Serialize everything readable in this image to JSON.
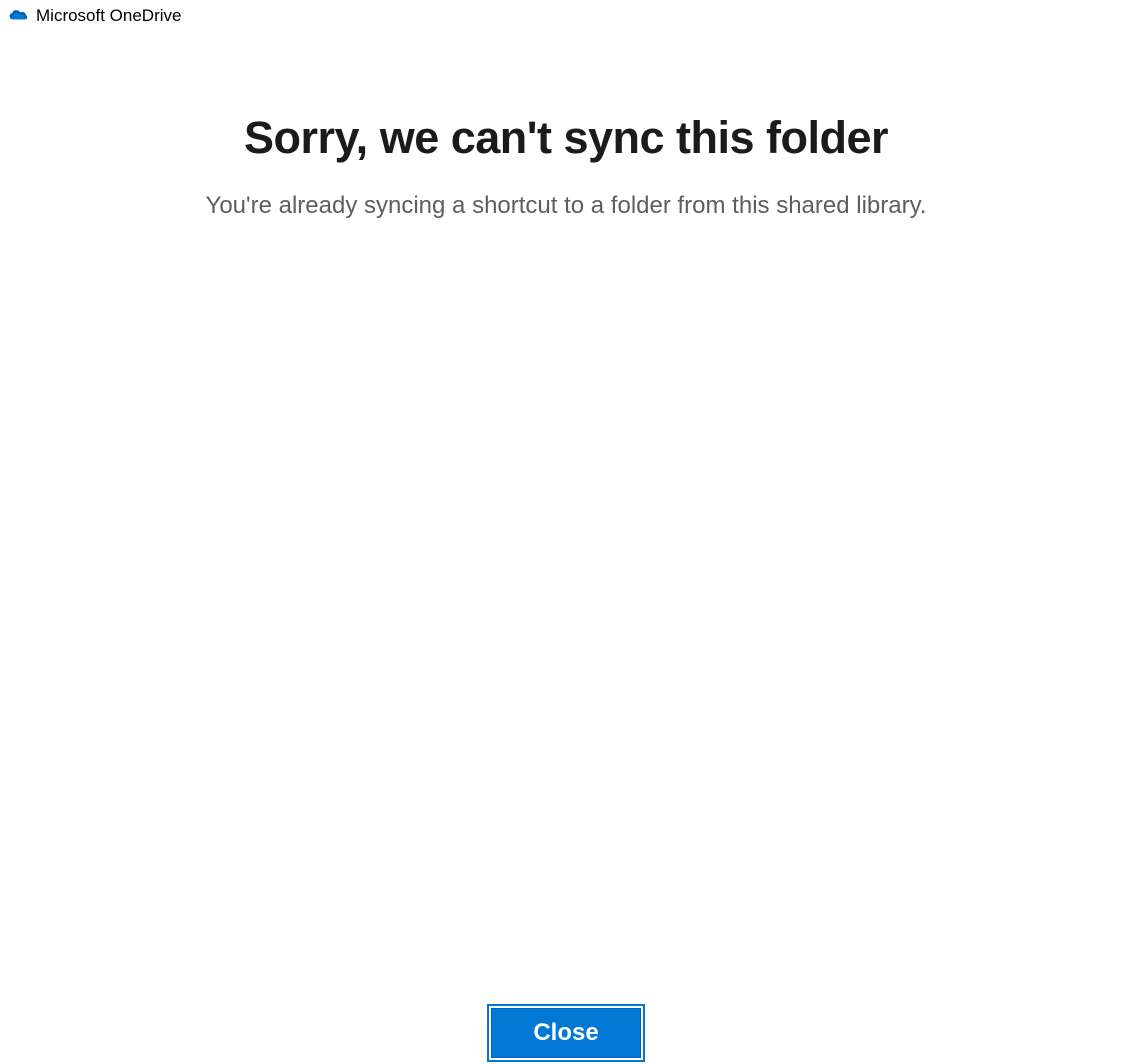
{
  "titlebar": {
    "app_name": "Microsoft OneDrive"
  },
  "dialog": {
    "heading": "Sorry, we can't sync this folder",
    "subtext": "You're already syncing a shortcut to a folder from this shared library."
  },
  "actions": {
    "close_label": "Close"
  },
  "colors": {
    "accent": "#0078d4",
    "heading": "#1b1b1b",
    "subtext": "#5e5e5e"
  }
}
